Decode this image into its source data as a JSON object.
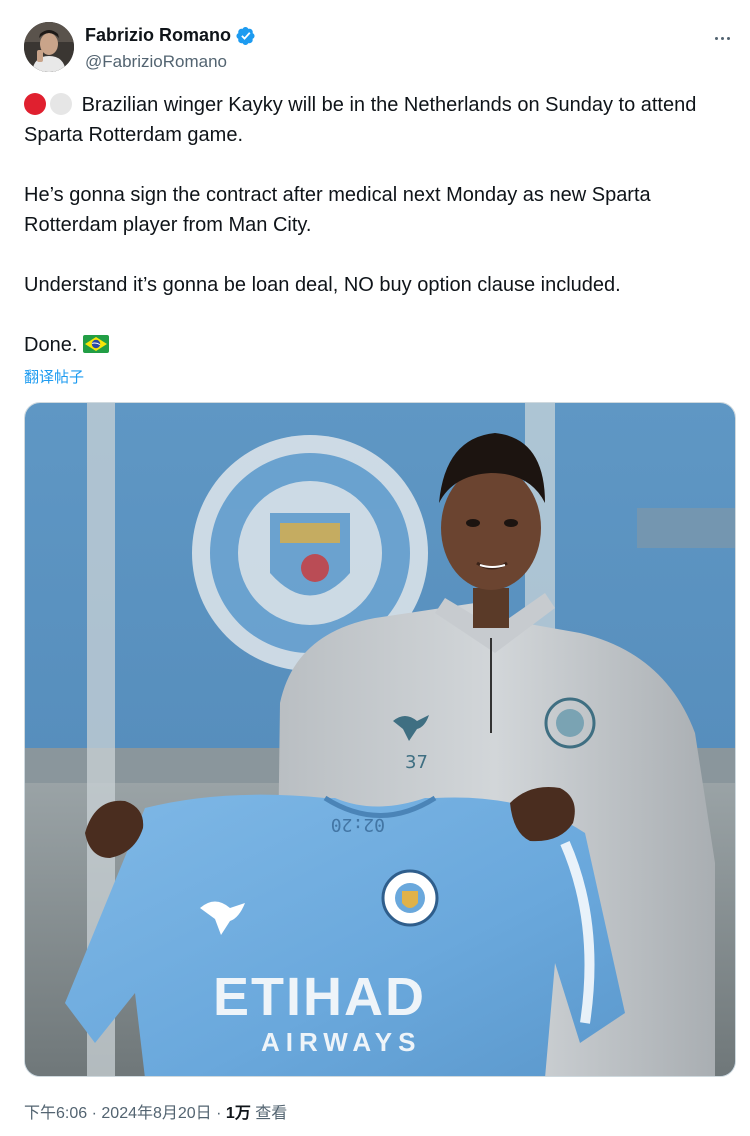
{
  "author": {
    "display_name": "Fabrizio Romano",
    "handle": "@FabrizioRomano",
    "verified": true,
    "icons": [
      "avatar",
      "verified-badge-icon",
      "more-options-icon"
    ]
  },
  "tweet": {
    "line1": "Brazilian winger Kayky will be in the Netherlands on Sunday to attend Sparta Rotterdam game.",
    "line2": "He’s gonna sign the contract after medical next Monday as new Sparta Rotterdam player from Man City.",
    "line3": "Understand it’s gonna be loan deal, NO buy option clause included.",
    "line4": "Done.",
    "emoji": [
      "red-circle",
      "white-circle",
      "brazil-flag"
    ]
  },
  "translate_label": "翻译帖子",
  "media": {
    "shirt_sponsor_top": "ETIHAD",
    "shirt_sponsor_bottom": "AIRWAYS",
    "jacket_number": "37"
  },
  "meta": {
    "time": "下午6:06",
    "date": "2024年8月20日",
    "views_count": "1万",
    "views_label": "查看",
    "separator": "·"
  },
  "colors": {
    "link": "#1d9bf0",
    "secondary_text": "#536471",
    "primary_text": "#0f1419",
    "city_blue": "#6cabdd"
  }
}
